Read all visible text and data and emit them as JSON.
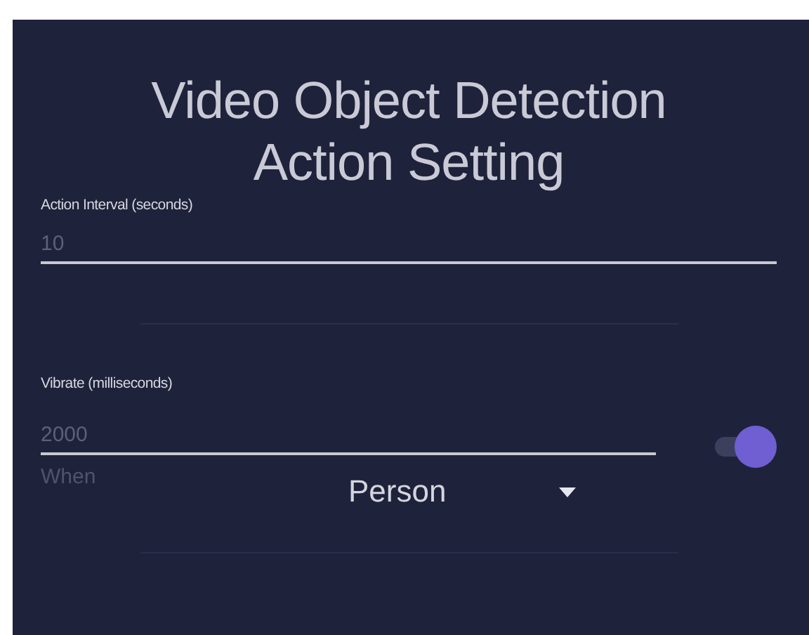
{
  "title": "Video Object Detection Action Setting",
  "fields": [
    {
      "label": "Action Interval (seconds)",
      "placeholder": "10"
    },
    {
      "label": "Vibrate (milliseconds)",
      "placeholder": "2000"
    }
  ],
  "vibrate_toggle": {
    "on": true
  },
  "when": {
    "label": "When",
    "value": "Person"
  }
}
